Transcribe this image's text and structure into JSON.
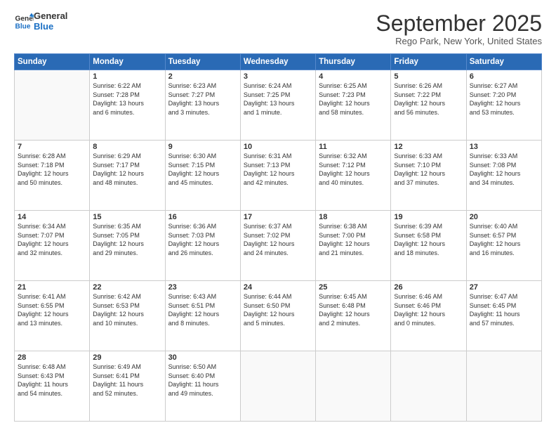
{
  "logo": {
    "line1": "General",
    "line2": "Blue"
  },
  "title": "September 2025",
  "location": "Rego Park, New York, United States",
  "days_header": [
    "Sunday",
    "Monday",
    "Tuesday",
    "Wednesday",
    "Thursday",
    "Friday",
    "Saturday"
  ],
  "weeks": [
    [
      {
        "day": "",
        "info": ""
      },
      {
        "day": "1",
        "info": "Sunrise: 6:22 AM\nSunset: 7:28 PM\nDaylight: 13 hours\nand 6 minutes."
      },
      {
        "day": "2",
        "info": "Sunrise: 6:23 AM\nSunset: 7:27 PM\nDaylight: 13 hours\nand 3 minutes."
      },
      {
        "day": "3",
        "info": "Sunrise: 6:24 AM\nSunset: 7:25 PM\nDaylight: 13 hours\nand 1 minute."
      },
      {
        "day": "4",
        "info": "Sunrise: 6:25 AM\nSunset: 7:23 PM\nDaylight: 12 hours\nand 58 minutes."
      },
      {
        "day": "5",
        "info": "Sunrise: 6:26 AM\nSunset: 7:22 PM\nDaylight: 12 hours\nand 56 minutes."
      },
      {
        "day": "6",
        "info": "Sunrise: 6:27 AM\nSunset: 7:20 PM\nDaylight: 12 hours\nand 53 minutes."
      }
    ],
    [
      {
        "day": "7",
        "info": "Sunrise: 6:28 AM\nSunset: 7:18 PM\nDaylight: 12 hours\nand 50 minutes."
      },
      {
        "day": "8",
        "info": "Sunrise: 6:29 AM\nSunset: 7:17 PM\nDaylight: 12 hours\nand 48 minutes."
      },
      {
        "day": "9",
        "info": "Sunrise: 6:30 AM\nSunset: 7:15 PM\nDaylight: 12 hours\nand 45 minutes."
      },
      {
        "day": "10",
        "info": "Sunrise: 6:31 AM\nSunset: 7:13 PM\nDaylight: 12 hours\nand 42 minutes."
      },
      {
        "day": "11",
        "info": "Sunrise: 6:32 AM\nSunset: 7:12 PM\nDaylight: 12 hours\nand 40 minutes."
      },
      {
        "day": "12",
        "info": "Sunrise: 6:33 AM\nSunset: 7:10 PM\nDaylight: 12 hours\nand 37 minutes."
      },
      {
        "day": "13",
        "info": "Sunrise: 6:33 AM\nSunset: 7:08 PM\nDaylight: 12 hours\nand 34 minutes."
      }
    ],
    [
      {
        "day": "14",
        "info": "Sunrise: 6:34 AM\nSunset: 7:07 PM\nDaylight: 12 hours\nand 32 minutes."
      },
      {
        "day": "15",
        "info": "Sunrise: 6:35 AM\nSunset: 7:05 PM\nDaylight: 12 hours\nand 29 minutes."
      },
      {
        "day": "16",
        "info": "Sunrise: 6:36 AM\nSunset: 7:03 PM\nDaylight: 12 hours\nand 26 minutes."
      },
      {
        "day": "17",
        "info": "Sunrise: 6:37 AM\nSunset: 7:02 PM\nDaylight: 12 hours\nand 24 minutes."
      },
      {
        "day": "18",
        "info": "Sunrise: 6:38 AM\nSunset: 7:00 PM\nDaylight: 12 hours\nand 21 minutes."
      },
      {
        "day": "19",
        "info": "Sunrise: 6:39 AM\nSunset: 6:58 PM\nDaylight: 12 hours\nand 18 minutes."
      },
      {
        "day": "20",
        "info": "Sunrise: 6:40 AM\nSunset: 6:57 PM\nDaylight: 12 hours\nand 16 minutes."
      }
    ],
    [
      {
        "day": "21",
        "info": "Sunrise: 6:41 AM\nSunset: 6:55 PM\nDaylight: 12 hours\nand 13 minutes."
      },
      {
        "day": "22",
        "info": "Sunrise: 6:42 AM\nSunset: 6:53 PM\nDaylight: 12 hours\nand 10 minutes."
      },
      {
        "day": "23",
        "info": "Sunrise: 6:43 AM\nSunset: 6:51 PM\nDaylight: 12 hours\nand 8 minutes."
      },
      {
        "day": "24",
        "info": "Sunrise: 6:44 AM\nSunset: 6:50 PM\nDaylight: 12 hours\nand 5 minutes."
      },
      {
        "day": "25",
        "info": "Sunrise: 6:45 AM\nSunset: 6:48 PM\nDaylight: 12 hours\nand 2 minutes."
      },
      {
        "day": "26",
        "info": "Sunrise: 6:46 AM\nSunset: 6:46 PM\nDaylight: 12 hours\nand 0 minutes."
      },
      {
        "day": "27",
        "info": "Sunrise: 6:47 AM\nSunset: 6:45 PM\nDaylight: 11 hours\nand 57 minutes."
      }
    ],
    [
      {
        "day": "28",
        "info": "Sunrise: 6:48 AM\nSunset: 6:43 PM\nDaylight: 11 hours\nand 54 minutes."
      },
      {
        "day": "29",
        "info": "Sunrise: 6:49 AM\nSunset: 6:41 PM\nDaylight: 11 hours\nand 52 minutes."
      },
      {
        "day": "30",
        "info": "Sunrise: 6:50 AM\nSunset: 6:40 PM\nDaylight: 11 hours\nand 49 minutes."
      },
      {
        "day": "",
        "info": ""
      },
      {
        "day": "",
        "info": ""
      },
      {
        "day": "",
        "info": ""
      },
      {
        "day": "",
        "info": ""
      }
    ]
  ]
}
